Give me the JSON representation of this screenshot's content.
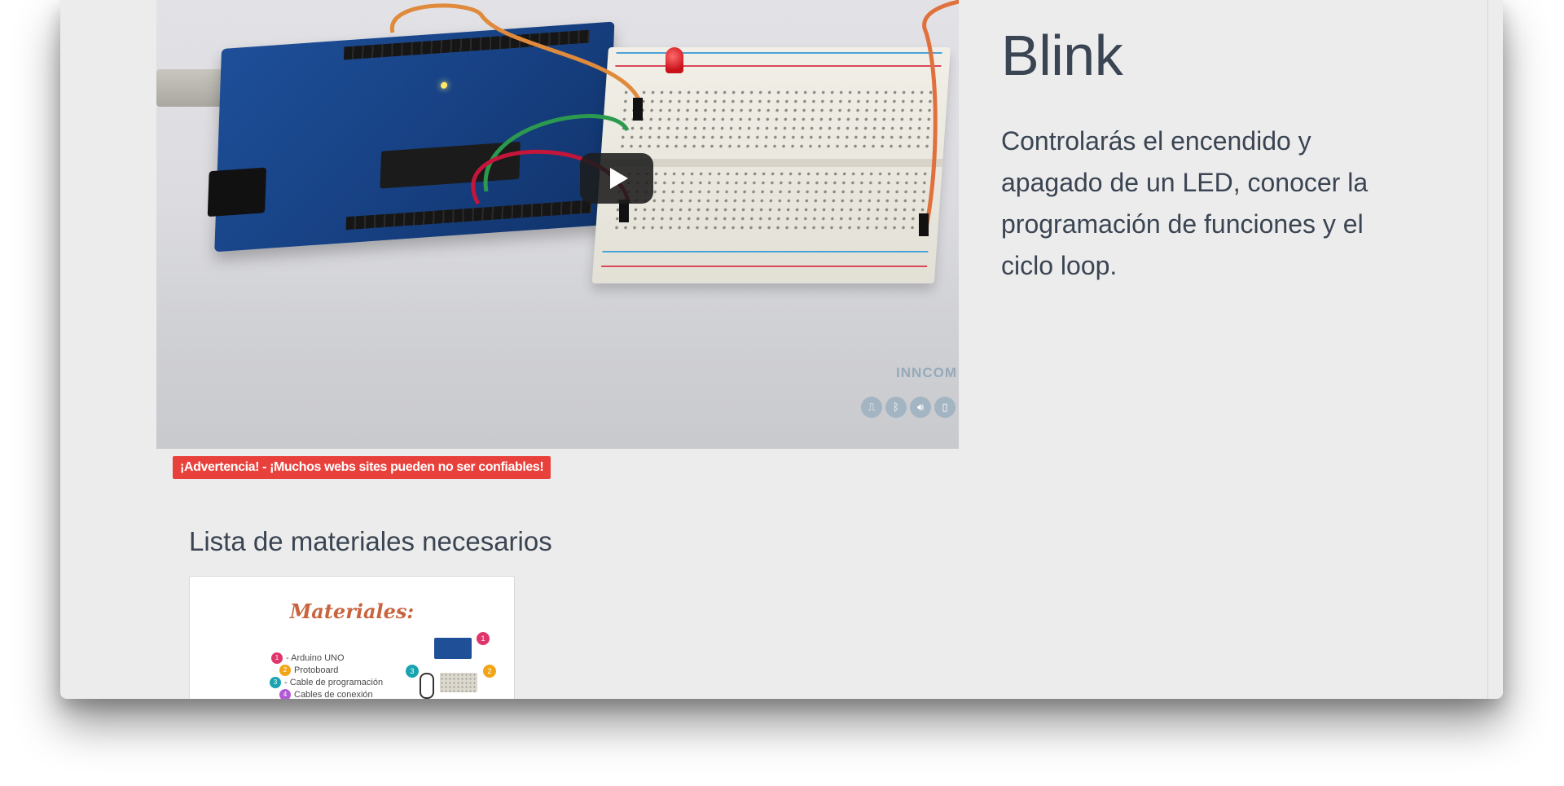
{
  "lesson": {
    "title": "Blink",
    "description": "Controlarás el encendido y apagado de un LED, conocer la programación de funciones y el ciclo loop."
  },
  "video": {
    "watermark": "INNCOM",
    "icons": [
      "usb-icon",
      "bluetooth-icon",
      "speaker-icon",
      "phone-icon"
    ]
  },
  "warning": {
    "text": "¡Advertencia! - ¡Muchos webs sites pueden no ser confiables!",
    "color": "#e8403b"
  },
  "materials": {
    "heading": "Lista de materiales necesarios",
    "card_title": "Materiales:",
    "items": [
      {
        "num": "1",
        "label": "- Arduino UNO",
        "color": "#e0356b"
      },
      {
        "num": "2",
        "label": "Protoboard",
        "color": "#f2a516"
      },
      {
        "num": "3",
        "label": "- Cable de programación",
        "color": "#19a3b0"
      },
      {
        "num": "4",
        "label": "Cables de conexión",
        "color": "#b25ad6"
      }
    ],
    "thumb_badges": [
      "1",
      "2",
      "3"
    ]
  },
  "colors": {
    "text": "#3a4452",
    "background": "#ececec",
    "accent": "#c8643e"
  }
}
